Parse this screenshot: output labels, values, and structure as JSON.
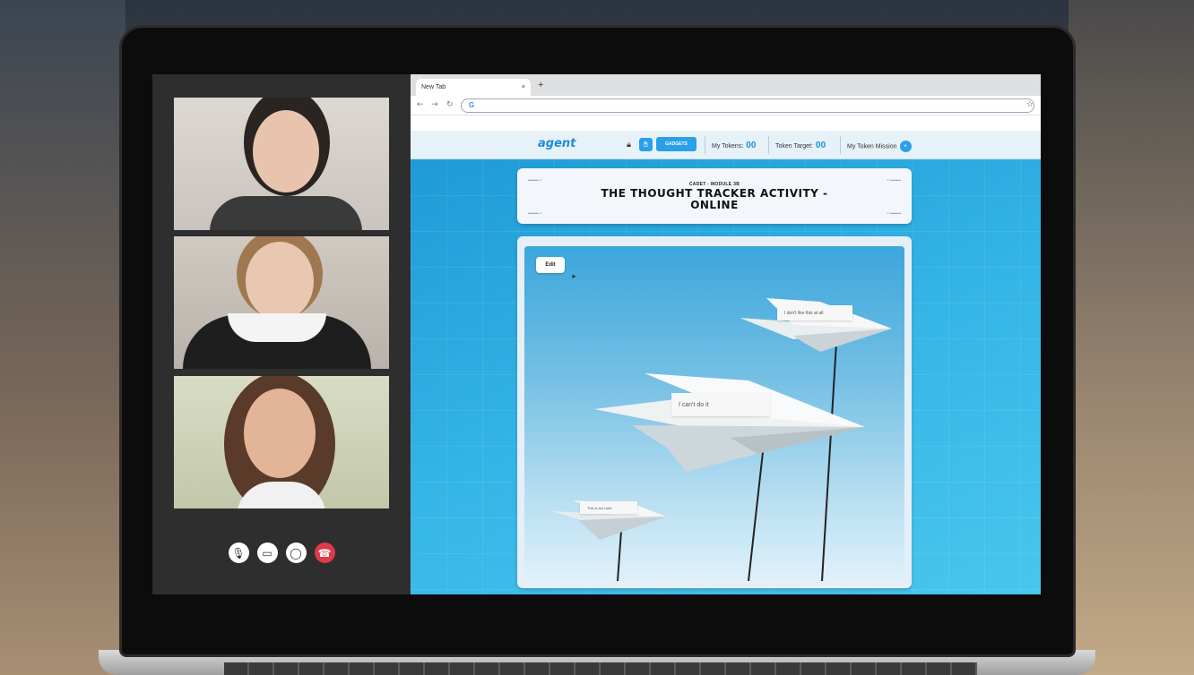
{
  "browser": {
    "tab_title": "New Tab",
    "tab_close": "×",
    "new_tab": "+",
    "omnibox_value": "G"
  },
  "app": {
    "logo_text": "agent",
    "gadgets_label": "GADGETS",
    "my_tokens_label": "My Tokens:",
    "my_tokens_value": "00",
    "token_target_label": "Token Target:",
    "token_target_value": "00",
    "mission_label": "My Token Mission",
    "mission_icon": "+"
  },
  "activity": {
    "module": "CADET - MODULE 3B",
    "title_line1": "THE THOUGHT TRACKER ACTIVITY -",
    "title_line2": "ONLINE",
    "edit_label": "Edit",
    "thoughts": [
      {
        "text": "I don't like this at all"
      },
      {
        "text": "I can't do it"
      },
      {
        "text": "This is too hard"
      }
    ]
  },
  "call": {
    "controls": [
      {
        "name": "mic-button",
        "icon": "microphone-icon",
        "glyph": "🎙"
      },
      {
        "name": "camera-button",
        "icon": "video-camera-icon",
        "glyph": "▭"
      },
      {
        "name": "chat-button",
        "icon": "chat-bubble-icon",
        "glyph": "◯"
      },
      {
        "name": "hangup-button",
        "icon": "phone-hangup-icon",
        "glyph": "☎"
      }
    ]
  },
  "colors": {
    "accent": "#2aa0e8",
    "hangup": "#e0394a"
  }
}
